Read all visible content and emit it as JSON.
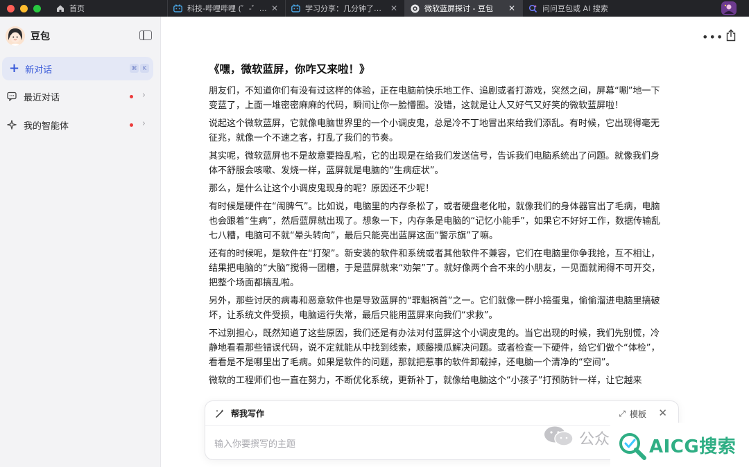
{
  "tabs": [
    {
      "label": "首页",
      "icon": "home-icon",
      "active": false
    },
    {
      "label": "科技-哔哩哔哩 (゜-゜)つロ",
      "icon": "bilibili-icon",
      "active": false
    },
    {
      "label": "学习分享：几分钟了解微软",
      "icon": "bilibili-icon",
      "active": false
    },
    {
      "label": "微软蓝屏探讨 - 豆包",
      "icon": "doubao-icon",
      "active": true
    },
    {
      "label": "问问豆包或 AI 搜索",
      "icon": "ai-search-icon",
      "active": false
    }
  ],
  "sidebar": {
    "brand": "豆包",
    "new_chat": "新对话",
    "shortcut": [
      "⌘",
      "K"
    ],
    "items": [
      {
        "label": "最近对话",
        "icon": "chat-bubble-icon",
        "has_dot": true
      },
      {
        "label": "我的智能体",
        "icon": "sparkle-icon",
        "has_dot": true
      }
    ]
  },
  "article": {
    "title": "《嘿，微软蓝屏，你咋又来啦！》",
    "paragraphs": [
      "朋友们，不知道你们有没有过这样的体验，正在电脑前快乐地工作、追剧或者打游戏，突然之间，屏幕“唰”地一下变蓝了，上面一堆密密麻麻的代码，瞬间让你一脸懵圈。没错，这就是让人又好气又好笑的微软蓝屏啦！",
      "说起这个微软蓝屏，它就像电脑世界里的一个小调皮鬼，总是冷不丁地冒出来给我们添乱。有时候，它出现得毫无征兆，就像一个不速之客，打乱了我们的节奏。",
      "其实呢，微软蓝屏也不是故意要捣乱啦，它的出现是在给我们发送信号，告诉我们电脑系统出了问题。就像我们身体不舒服会咳嗽、发烧一样，蓝屏就是电脑的“生病症状”。",
      "那么，是什么让这个小调皮鬼现身的呢？原因还不少呢！",
      "有时候是硬件在“闹脾气”。比如说，电脑里的内存条松了，或者硬盘老化啦，就像我们的身体器官出了毛病，电脑也会跟着“生病”，然后蓝屏就出现了。想象一下，内存条是电脑的“记忆小能手”，如果它不好好工作，数据传输乱七八糟，电脑可不就“晕头转向”，最后只能亮出蓝屏这面“警示旗”了嘛。",
      "还有的时候呢，是软件在“打架”。新安装的软件和系统或者其他软件不兼容，它们在电脑里你争我抢，互不相让，结果把电脑的“大脑”搅得一团糟，于是蓝屏就来“劝架”了。就好像两个合不来的小朋友，一见面就闹得不可开交，把整个场面都搞乱啦。",
      "另外，那些讨厌的病毒和恶意软件也是导致蓝屏的“罪魁祸首”之一。它们就像一群小捣蛋鬼，偷偷溜进电脑里搞破坏，让系统文件受损，电脑运行失常，最后只能用蓝屏来向我们“求救”。",
      "不过别担心，既然知道了这些原因，我们还是有办法对付蓝屏这个小调皮鬼的。当它出现的时候，我们先别慌，冷静地看看那些错误代码，说不定就能从中找到线索，顺藤摸瓜解决问题。或者检查一下硬件，给它们做个“体检”，看看是不是哪里出了毛病。如果是软件的问题，那就把惹事的软件卸载掉，还电脑一个清净的“空间”。",
      "微软的工程师们也一直在努力，不断优化系统，更新补丁，就像给电脑这个“小孩子”打预防针一样，让它越来"
    ]
  },
  "write_card": {
    "title": "帮我写作",
    "template_label": "模板",
    "placeholder": "输入你要撰写的主题"
  },
  "watermark": {
    "wechat_text": "公众",
    "brand": "AICG搜索"
  },
  "colors": {
    "accent": "#3a5bd9",
    "dot": "#ec3b3b",
    "tabbar": "#232428",
    "watermark_green": "#2fae84"
  }
}
